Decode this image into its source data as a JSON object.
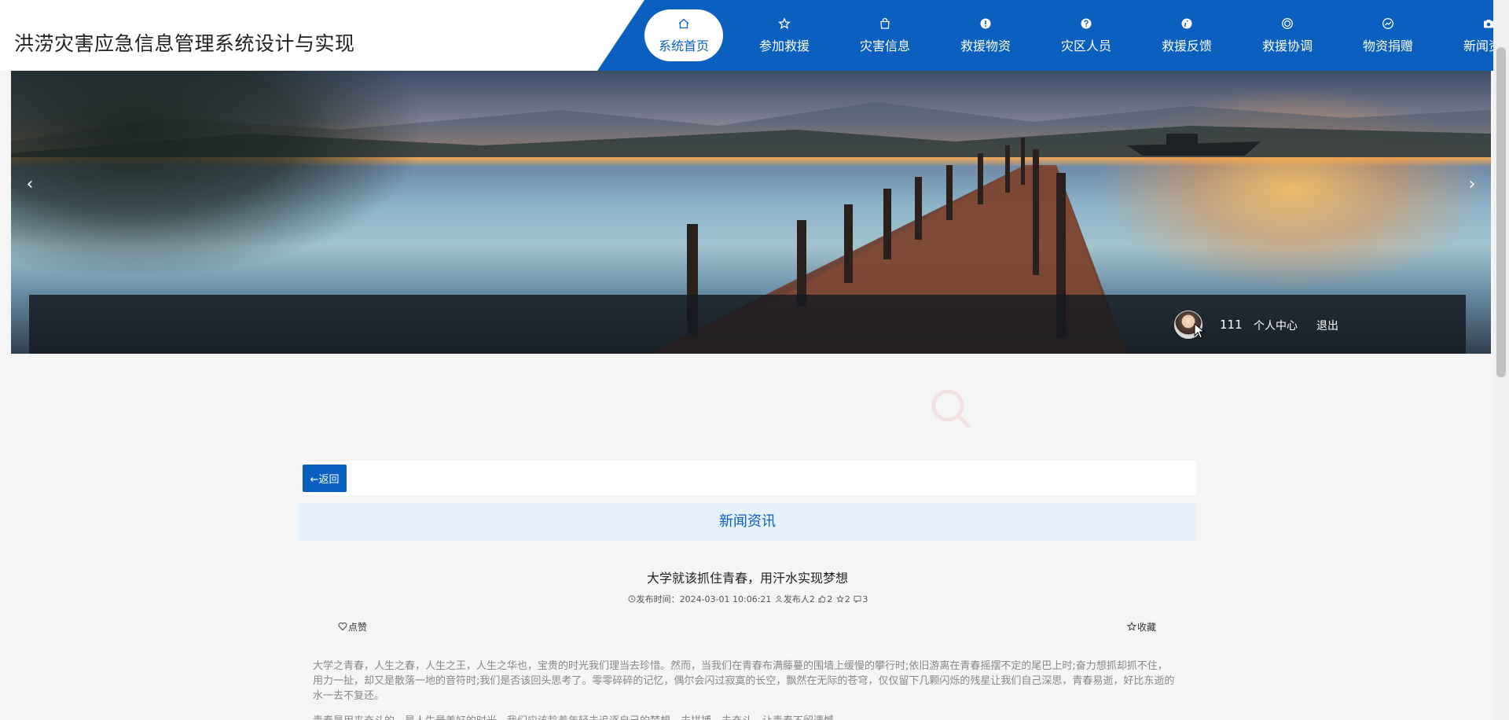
{
  "site": {
    "title": "洪涝灾害应急信息管理系统设计与实现"
  },
  "nav": {
    "items": [
      {
        "label": "系统首页",
        "icon": "home-icon"
      },
      {
        "label": "参加救援",
        "icon": "star-icon"
      },
      {
        "label": "灾害信息",
        "icon": "bag-icon"
      },
      {
        "label": "救援物资",
        "icon": "alert-icon"
      },
      {
        "label": "灾区人员",
        "icon": "question-icon"
      },
      {
        "label": "救援反馈",
        "icon": "info-icon"
      },
      {
        "label": "救援协调",
        "icon": "target-icon"
      },
      {
        "label": "物资捐赠",
        "icon": "chart-icon"
      },
      {
        "label": "新闻资讯",
        "icon": "camera-icon"
      }
    ],
    "active_index": 0
  },
  "banner": {
    "prev": "‹",
    "next": "›"
  },
  "user": {
    "name": "111",
    "center_label": "个人中心",
    "logout_label": "退出"
  },
  "content": {
    "back_label": "←返回",
    "section_title": "新闻资讯",
    "article_title": "大学就该抓住青春，用汗水实现梦想",
    "meta": {
      "time_prefix": "发布时间：",
      "time": "2024-03-01 10:06:21",
      "publisher": "发布人2",
      "likes": "2",
      "favorites": "2",
      "views": "3"
    },
    "like_label": "点赞",
    "fav_label": "收藏",
    "body": "大学之青春，人生之春，人生之王，人生之华也，宝贵的时光我们理当去珍惜。然而，当我们在青春布满藤蔓的围墙上缓慢的攀行时;依旧游离在青春摇摆不定的尾巴上时;奋力想抓却抓不住，用力一扯，却又是散落一地的音符时;我们是否该回头思考了。零零碎碎的记忆，偶尔会闪过寂寞的长空，飘然在无际的苍穹，仅仅留下几颗闪烁的残星让我们自己深思，青春易逝，好比东逝的水一去不复还。",
    "body2": "青春是用来奋斗的，是人生最美好的时光，我们应该趁着年轻去追逐自己的梦想，去拼搏，去奋斗，让青春不留遗憾。"
  },
  "colors": {
    "brand": "#0a5fbf",
    "section_bg": "#e6f1fb"
  }
}
